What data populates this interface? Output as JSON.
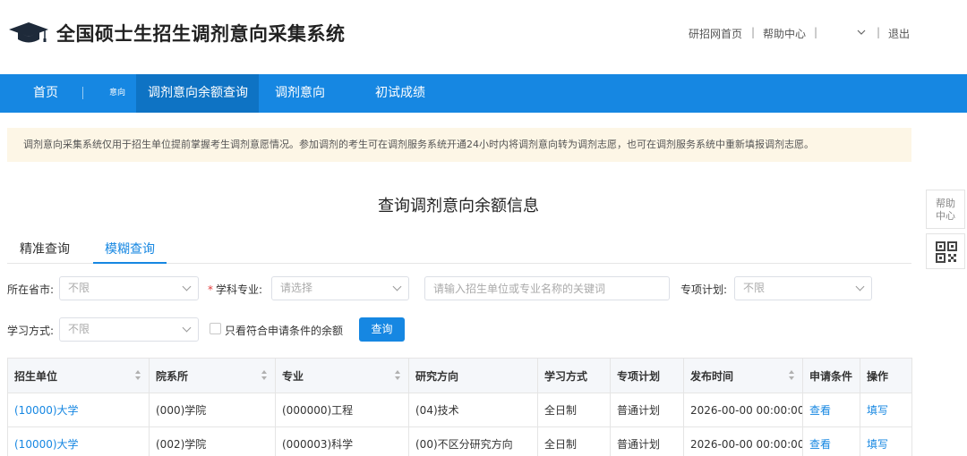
{
  "header": {
    "title": "全国硕士生招生调剂意向采集系统",
    "links": [
      "研招网首页",
      "帮助中心"
    ],
    "user_name": "",
    "logout": "退出",
    "separator": "|"
  },
  "nav": {
    "items": [
      {
        "label": "首页",
        "active": false
      },
      {
        "label": "调剂意向余额查询",
        "active": true
      },
      {
        "label": "调剂意向",
        "active": false
      },
      {
        "label": "初试成绩",
        "active": false
      }
    ],
    "small_label": "意向",
    "separator": "|"
  },
  "notice": "调剂意向采集系统仅用于招生单位提前掌握考生调剂意愿情况。参加调剂的考生可在调剂服务系统开通24小时内将调剂意向转为调剂志愿，也可在调剂服务系统中重新填报调剂志愿。",
  "side": {
    "help_line1": "帮助",
    "help_line2": "中心",
    "qr_icon": "qr-code-icon"
  },
  "section_title": "查询调剂意向余额信息",
  "tabs": [
    {
      "label": "精准查询",
      "active": false
    },
    {
      "label": "模糊查询",
      "active": true
    }
  ],
  "filters": {
    "province_label": "所在省市:",
    "province_value": "不限",
    "major_required": "*",
    "major_label": "学科专业:",
    "major_placeholder": "请选择",
    "keyword_placeholder": "请输入招生单位或专业名称的关键词",
    "special_label": "专项计划:",
    "special_value": "不限",
    "study_label": "学习方式:",
    "study_value": "不限",
    "checkbox_label": "只看符合申请条件的余额",
    "query_button": "查询"
  },
  "table": {
    "headers": [
      "招生单位",
      "院系所",
      "专业",
      "研究方向",
      "学习方式",
      "专项计划",
      "发布时间",
      "申请条件",
      "操作"
    ],
    "rows": [
      [
        "(10000)大学",
        "(000)学院",
        "(000000)工程",
        "(04)技术",
        "全日制",
        "普通计划",
        "2026-00-00 00:00:00",
        "查看",
        "填写"
      ],
      [
        "(10000)大学",
        "(002)学院",
        "(000003)科学",
        "(00)不区分研究方向",
        "全日制",
        "普通计划",
        "2026-00-00 00:00:00",
        "查看",
        "填写"
      ]
    ]
  },
  "colors": {
    "primary": "#1687e2",
    "nav_active": "#0e73c4",
    "notice_bg": "#fdf6e6",
    "required": "#e23c3c"
  }
}
